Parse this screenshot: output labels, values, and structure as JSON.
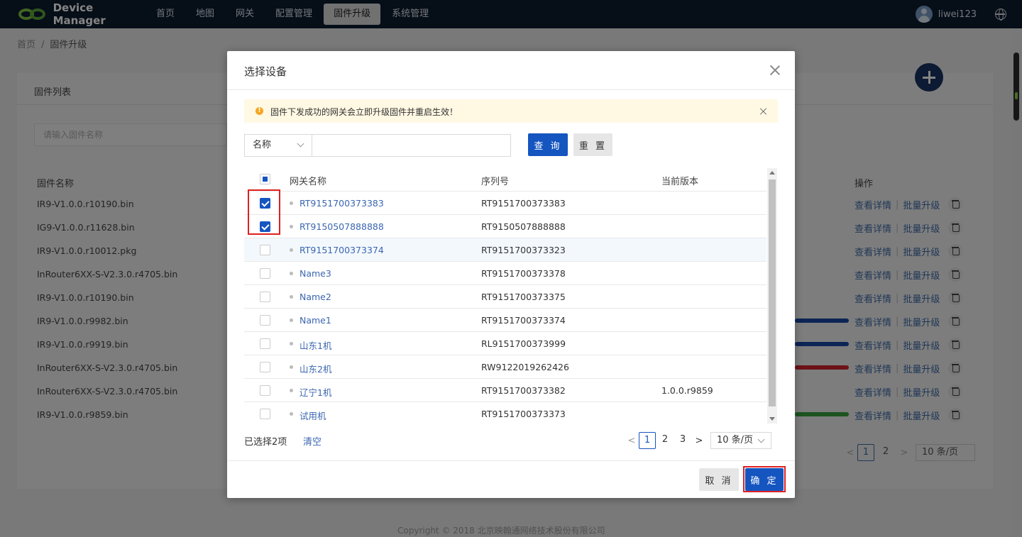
{
  "app": {
    "title": "Device Manager",
    "nav": [
      "首页",
      "地图",
      "网关",
      "配置管理",
      "固件升级",
      "系统管理"
    ],
    "active_nav": 4,
    "username": "liwei123"
  },
  "breadcrumb": [
    "首页",
    "固件升级"
  ],
  "background": {
    "panel_title": "固件列表",
    "search_placeholder": "请输入固件名称",
    "columns": [
      "固件名称",
      "操作"
    ],
    "rows": [
      "IR9-V1.0.0.r10190.bin",
      "IG9-V1.0.0.r11628.bin",
      "IR9-V1.0.0.r10012.pkg",
      "InRouter6XX-S-V2.3.0.r4705.bin",
      "IR9-V1.0.0.r10190.bin",
      "IR9-V1.0.0.r9982.bin",
      "IR9-V1.0.0.r9919.bin",
      "InRouter6XX-S-V2.3.0.r4705.bin",
      "InRouter6XX-S-V2.3.0.r4705.bin",
      "IR9-V1.0.0.r9859.bin"
    ],
    "action_detail": "查看详情",
    "action_upgrade": "批量升级",
    "progress_bars": [
      {
        "row": 5,
        "color": "#1747a6"
      },
      {
        "row": 6,
        "color": "#1747a6"
      },
      {
        "row": 7,
        "color": "#d0262e"
      },
      {
        "row": 9,
        "color": "#38a03c"
      }
    ],
    "pager": {
      "pages": [
        "1",
        "2"
      ],
      "current": "1",
      "page_size": "10 条/页"
    },
    "footer": "Copyright © 2018 北京映翰通网络技术股份有限公司"
  },
  "modal": {
    "title": "选择设备",
    "alert": "固件下发成功的网关会立即升级固件并重启生效！",
    "filter": {
      "field": "名称",
      "value": "",
      "query_label": "查 询",
      "reset_label": "重 置"
    },
    "columns": [
      "网关名称",
      "序列号",
      "当前版本"
    ],
    "rows": [
      {
        "name": "RT9151700373383",
        "sn": "RT9151700373383",
        "version": "",
        "checked": true
      },
      {
        "name": "RT9150507888888",
        "sn": "RT9150507888888",
        "version": "",
        "checked": true
      },
      {
        "name": "RT9151700373374",
        "sn": "RT9151700373323",
        "version": "",
        "checked": false
      },
      {
        "name": "Name3",
        "sn": "RT9151700373378",
        "version": "",
        "checked": false
      },
      {
        "name": "Name2",
        "sn": "RT9151700373375",
        "version": "",
        "checked": false
      },
      {
        "name": "Name1",
        "sn": "RT9151700373374",
        "version": "",
        "checked": false
      },
      {
        "name": "山东1机",
        "sn": "RL9151700373999",
        "version": "",
        "checked": false
      },
      {
        "name": "山东2机",
        "sn": "RW9122019262426",
        "version": "",
        "checked": false
      },
      {
        "name": "辽宁1机",
        "sn": "RT9151700373382",
        "version": "1.0.0.r9859",
        "checked": false
      },
      {
        "name": "试用机",
        "sn": "RT9151700373373",
        "version": "",
        "checked": false
      }
    ],
    "selected_text": "已选择2项",
    "clear_label": "清空",
    "pager": {
      "pages": [
        "1",
        "2",
        "3"
      ],
      "current": "1",
      "page_size": "10 条/页"
    },
    "cancel_label": "取 消",
    "ok_label": "确 定"
  },
  "colors": {
    "accent": "#1555c0",
    "nav_bg": "#0d1b2e",
    "highlight_box": "#e02020"
  }
}
